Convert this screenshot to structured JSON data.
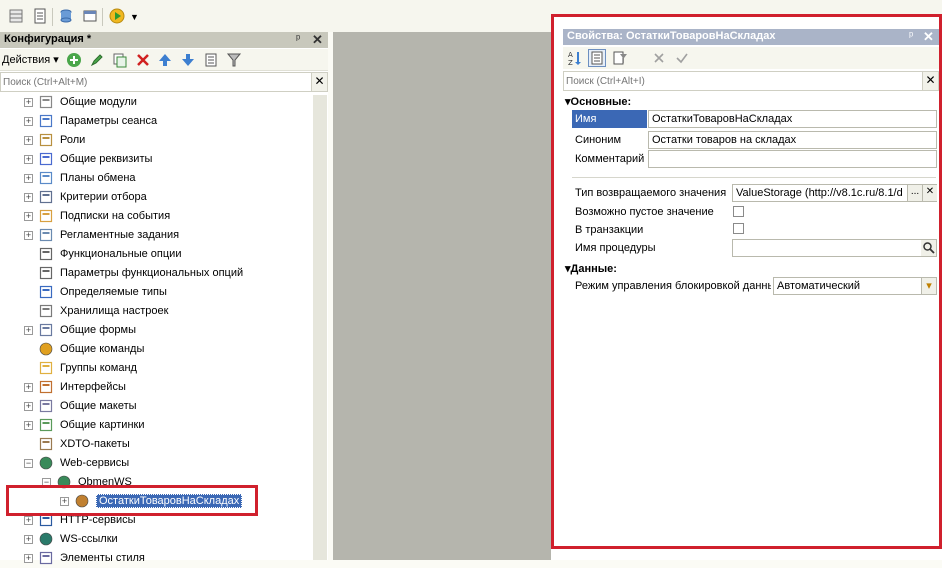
{
  "config_panel": {
    "title": "Конфигурация *",
    "pin_label": "ᵖ",
    "close_label": "✕",
    "actions_label": "Действия ▾",
    "search_placeholder": "Поиск (Ctrl+Alt+M)",
    "tree": [
      {
        "label": "Общие модули",
        "icon": "common-modules-icon"
      },
      {
        "label": "Параметры сеанса",
        "icon": "session-params-icon"
      },
      {
        "label": "Роли",
        "icon": "roles-icon"
      },
      {
        "label": "Общие реквизиты",
        "icon": "common-attributes-icon"
      },
      {
        "label": "Планы обмена",
        "icon": "exchange-plans-icon"
      },
      {
        "label": "Критерии отбора",
        "icon": "filter-criteria-icon"
      },
      {
        "label": "Подписки на события",
        "icon": "event-subscriptions-icon"
      },
      {
        "label": "Регламентные задания",
        "icon": "scheduled-jobs-icon"
      },
      {
        "label": "Функциональные опции",
        "icon": "functional-options-icon"
      },
      {
        "label": "Параметры функциональных опций",
        "icon": "functional-option-params-icon"
      },
      {
        "label": "Определяемые типы",
        "icon": "defined-types-icon"
      },
      {
        "label": "Хранилища настроек",
        "icon": "settings-storages-icon"
      },
      {
        "label": "Общие формы",
        "icon": "common-forms-icon"
      },
      {
        "label": "Общие команды",
        "icon": "common-commands-icon"
      },
      {
        "label": "Группы команд",
        "icon": "command-groups-icon"
      },
      {
        "label": "Интерфейсы",
        "icon": "interfaces-icon"
      },
      {
        "label": "Общие макеты",
        "icon": "common-templates-icon"
      },
      {
        "label": "Общие картинки",
        "icon": "common-pictures-icon"
      },
      {
        "label": "XDTO-пакеты",
        "icon": "xdto-packages-icon"
      },
      {
        "label": "Web-сервисы",
        "icon": "web-services-icon"
      },
      {
        "label": "ObmenWS",
        "icon": "web-service-icon"
      },
      {
        "label": "ОстаткиТоваровНаСкладах",
        "icon": "operation-icon"
      },
      {
        "label": "HTTP-сервисы",
        "icon": "http-services-icon"
      },
      {
        "label": "WS-ссылки",
        "icon": "ws-references-icon"
      },
      {
        "label": "Элементы стиля",
        "icon": "style-items-icon"
      }
    ]
  },
  "props_panel": {
    "title": "Свойства: ОстаткиТоваровНаСкладах",
    "pin_label": "ᵖ",
    "close_label": "✕",
    "search_placeholder": "Поиск (Ctrl+Alt+I)",
    "sections": {
      "main": "Основные:",
      "data": "Данные:"
    },
    "fields": {
      "name_label": "Имя",
      "name_value": "ОстаткиТоваровНаСкладах",
      "synonym_label": "Синоним",
      "synonym_value": "Остатки товаров на складах",
      "comment_label": "Комментарий",
      "comment_value": "",
      "return_type_label": "Тип возвращаемого значения",
      "return_type_value": "ValueStorage (http://v8.1c.ru/8.1/d",
      "nullable_label": "Возможно пустое значение",
      "transaction_label": "В транзакции",
      "procedure_label": "Имя процедуры",
      "procedure_value": "",
      "lock_mode_label": "Режим управления блокировкой данны",
      "lock_mode_value": "Автоматический",
      "ellipsis_label": "...",
      "clear_label": "✕",
      "dropdown_label": "▾"
    }
  },
  "colors": {
    "highlight_red": "#d0202d",
    "selection_blue": "#3b68b5",
    "panel_title_gray": "#c8c8bc",
    "mdi_gray": "#b5b5ad"
  }
}
